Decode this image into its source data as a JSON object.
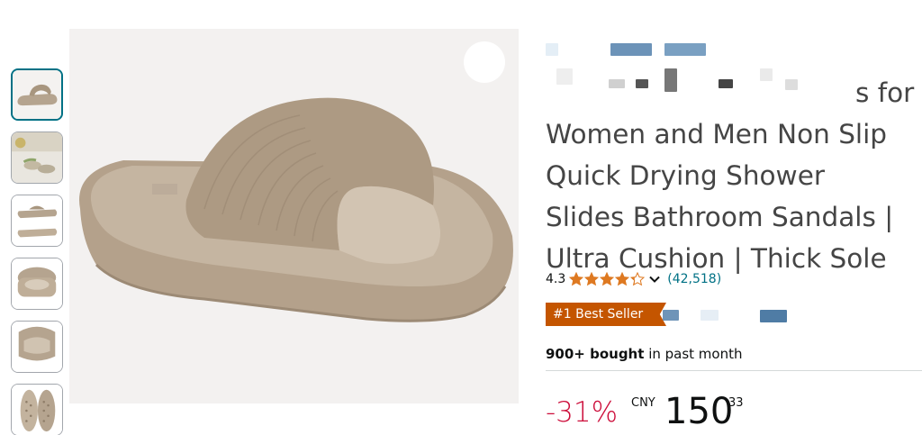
{
  "product": {
    "title_lines": [
      "s for",
      "Women and Men Non Slip",
      "Quick Drying Shower",
      "Slides Bathroom Sandals |",
      "Ultra Cushion | Thick Sole"
    ],
    "rating": "4.3",
    "stars_filled": 4.3,
    "review_count": "(42,518)",
    "badge": "#1 Best Seller",
    "bought_bold": "900+ bought",
    "bought_rest": " in past month",
    "price": {
      "discount": "-31%",
      "currency": "CNY",
      "whole": "150",
      "fraction": "33"
    }
  },
  "thumbnails": [
    {
      "name": "slide-side-view"
    },
    {
      "name": "slides-lifestyle"
    },
    {
      "name": "slides-top-bottom"
    },
    {
      "name": "slide-front-view"
    },
    {
      "name": "slide-back-view"
    },
    {
      "name": "slide-sole-view"
    }
  ],
  "colors": {
    "accent_link": "#007185",
    "badge_bg": "#c45500",
    "discount": "#cc0c39",
    "star": "#de7921",
    "product_tan": "#b8a792"
  }
}
